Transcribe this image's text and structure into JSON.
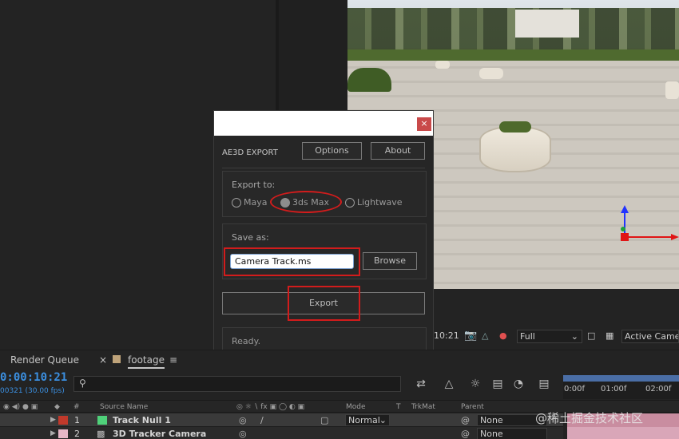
{
  "dialog": {
    "title": "AE3D EXPORT",
    "close_label": "×",
    "options_label": "Options",
    "about_label": "About",
    "export_to_label": "Export to:",
    "export_options": [
      "Maya",
      "3ds Max",
      "Lightwave"
    ],
    "selected_option": "3ds Max",
    "save_as_label": "Save as:",
    "save_as_value": "Camera Track.ms",
    "browse_label": "Browse",
    "export_label": "Export",
    "status": "Ready."
  },
  "viewer_footer": {
    "timecode": "10:21",
    "resolution": "Full",
    "view": "Active Camer"
  },
  "tabs": {
    "render_queue": "Render Queue",
    "close": "×",
    "footage": "footage",
    "menu": "≡"
  },
  "timeline": {
    "timecode": "0:00:10:21",
    "fps": "00321 (30.00 fps)",
    "search_icon": "⚲",
    "ruler": [
      "0:00f",
      "01:00f",
      "02:00f"
    ]
  },
  "columns": {
    "number": "#",
    "source_name": "Source Name",
    "mode": "Mode",
    "t": "T",
    "trkmat": "TrkMat",
    "parent": "Parent"
  },
  "layers": [
    {
      "num": "1",
      "name": "Track Null 1",
      "mode": "Normal",
      "parent": "None",
      "color": "#4fd17a"
    },
    {
      "num": "2",
      "name": "3D Tracker Camera",
      "mode": "",
      "parent": "None",
      "color": "#e7b7c7"
    }
  ],
  "watermark": "@稀土掘金技术社区",
  "colors": {
    "accent_blue": "#3b8fe0",
    "annotation_red": "#d21c1c"
  }
}
